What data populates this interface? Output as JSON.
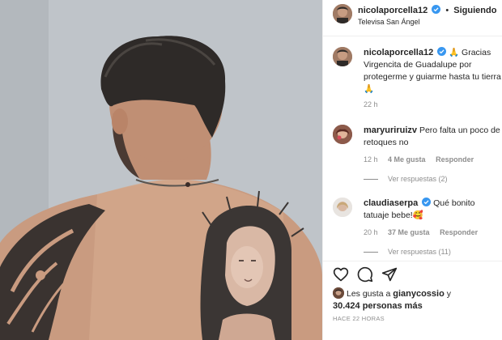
{
  "post": {
    "username": "nicolaporcella12",
    "follow_label": "Siguiendo",
    "separator": "•",
    "location": "Televisa San Ángel"
  },
  "caption": {
    "username": "nicolaporcella12",
    "text": "🙏 Gracias Virgencita de Guadalupe por protegerme y guiarme hasta tu tierra 🙏",
    "time": "22 h"
  },
  "comments": [
    {
      "username": "maryuriruizv",
      "text": "Pero falta un poco de retoques no",
      "time": "12 h",
      "likes": "4 Me gusta",
      "reply": "Responder",
      "view_replies": "Ver respuestas (2)"
    },
    {
      "username": "claudiaserpa",
      "text": "Qué bonito tatuaje bebe!🥰",
      "time": "20 h",
      "likes": "37 Me gusta",
      "reply": "Responder",
      "view_replies": "Ver respuestas (11)"
    }
  ],
  "likes_summary": {
    "prefix": "Les gusta a",
    "user": "gianycossio",
    "mid": "y",
    "count": "30.424 personas más"
  },
  "timestamp": "HACE 22 HORAS",
  "icons": [
    "heart-icon",
    "comment-icon",
    "share-icon",
    "verified-icon"
  ],
  "colors": {
    "verified": "#3897f0",
    "muted": "#8e8e8e",
    "text": "#262626"
  }
}
